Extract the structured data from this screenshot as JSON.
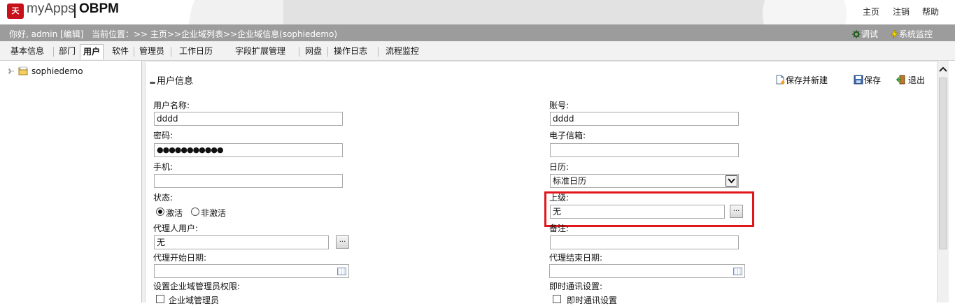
{
  "header": {
    "logo_text": "myApps",
    "logo_obpm": "OBPM",
    "links": [
      "主页",
      "注销",
      "帮助"
    ]
  },
  "status": {
    "greeting": "你好, admin [编辑]",
    "location": "当前位置：>> 主页>>企业域列表>>企业域信息(sophiedemo)",
    "debug": "调试",
    "monitor": "系统监控"
  },
  "tabs": [
    "基本信息",
    "部门",
    "用户",
    "软件",
    "管理员",
    "工作日历",
    "字段扩展管理",
    "网盘",
    "操作日志",
    "流程监控"
  ],
  "active_tab": "用户",
  "tree": {
    "root": "sophiedemo"
  },
  "panel": {
    "title": "用户信息",
    "actions": {
      "save_new": "保存并新建",
      "save": "保存",
      "exit": "退出"
    }
  },
  "form": {
    "username": {
      "label": "用户名称:",
      "value": "dddd"
    },
    "account": {
      "label": "账号:",
      "value": "dddd"
    },
    "password": {
      "label": "密码:",
      "value": "●●●●●●●●●●●"
    },
    "email": {
      "label": "电子信箱:",
      "value": ""
    },
    "phone": {
      "label": "手机:",
      "value": ""
    },
    "calendar": {
      "label": "日历:",
      "value": "标准日历"
    },
    "state": {
      "label": "状态:",
      "options": [
        "激活",
        "非激活"
      ],
      "selected": "激活"
    },
    "superior": {
      "label": "上级:",
      "value": "无"
    },
    "proxy": {
      "label": "代理人用户:",
      "value": "无"
    },
    "remark": {
      "label": "备注:",
      "value": ""
    },
    "proxy_start": {
      "label": "代理开始日期:",
      "value": ""
    },
    "proxy_end": {
      "label": "代理结束日期:",
      "value": ""
    },
    "domain_admin": {
      "label": "设置企业域管理员权限:",
      "checkbox": "企业域管理员"
    },
    "im": {
      "label": "即时通讯设置:",
      "checkbox": "即时通讯设置"
    }
  },
  "colors": {
    "highlight_box": "#e0161c",
    "status_bar": "#9c9c9c"
  }
}
